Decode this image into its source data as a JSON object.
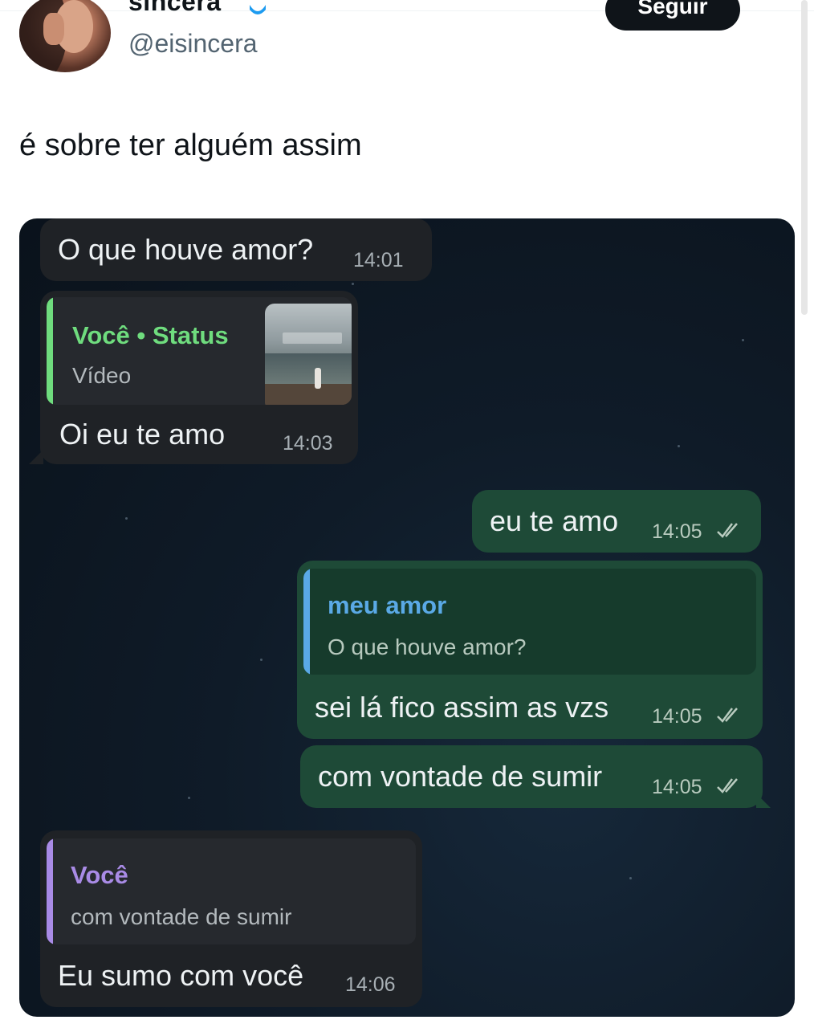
{
  "tweet": {
    "display_name": "sincera",
    "handle": "@eisincera",
    "follow_label": "Seguir",
    "text": "é sobre ter alguém assim"
  },
  "chat": {
    "messages": [
      {
        "text": "O que houve amor?",
        "time": "14:01"
      },
      {
        "quote_title": "Você • Status",
        "quote_sub": "Vídeo",
        "text": "Oi eu te amo",
        "time": "14:03"
      },
      {
        "text": "eu te amo",
        "time": "14:05"
      },
      {
        "quote_title": "meu amor",
        "quote_sub": "O que houve amor?",
        "text": "sei lá fico assim as vzs",
        "time": "14:05"
      },
      {
        "text": "com vontade de sumir",
        "time": "14:05"
      },
      {
        "quote_title": "Você",
        "quote_sub": "com vontade de sumir",
        "text": "Eu sumo com você",
        "time": "14:06"
      }
    ]
  },
  "colors": {
    "status_quote": "#6fdc7e",
    "reply_quote_out": "#5aa9e6",
    "reply_quote_in": "#a98be6",
    "bubble_in": "#1f2226",
    "bubble_out": "#1e4a37"
  }
}
